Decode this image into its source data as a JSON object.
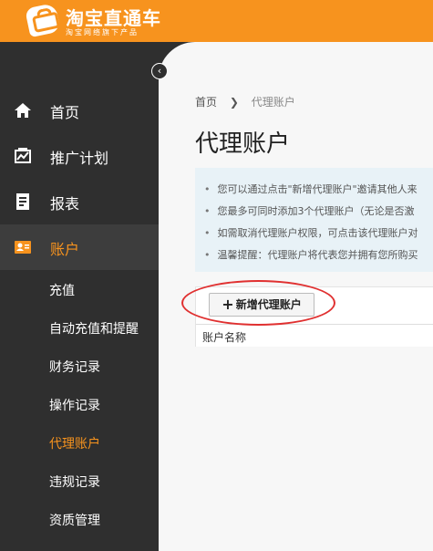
{
  "header": {
    "logo_title": "淘宝直通车",
    "logo_subtitle": "淘宝网络旗下产品",
    "brand_color": "#f7931e"
  },
  "sidebar": {
    "bg_color": "#2f2f2f",
    "collapse_icon": "chevron-left-icon",
    "items": [
      {
        "label": "首页",
        "icon": "home-icon"
      },
      {
        "label": "推广计划",
        "icon": "campaign-icon"
      },
      {
        "label": "报表",
        "icon": "report-icon"
      },
      {
        "label": "账户",
        "icon": "account-icon",
        "active": true
      }
    ],
    "sub_items": [
      {
        "label": "充值"
      },
      {
        "label": "自动充值和提醒"
      },
      {
        "label": "财务记录"
      },
      {
        "label": "操作记录"
      },
      {
        "label": "代理账户",
        "active": true
      },
      {
        "label": "违规记录"
      },
      {
        "label": "资质管理"
      }
    ]
  },
  "breadcrumb": {
    "home": "首页",
    "separator": "❯",
    "current": "代理账户"
  },
  "page_title": "代理账户",
  "notice": {
    "lines": [
      "您可以通过点击\"新增代理账户\"邀请其他人来",
      "您最多可同时添加3个代理账户（无论是否激",
      "如需取消代理账户权限，可点击该代理账户对",
      "温馨提醒：代理账户将代表您并拥有您所购买"
    ]
  },
  "panel": {
    "add_button_label": "新增代理账户",
    "add_button_icon": "plus-icon",
    "column_header": "账户名称"
  },
  "annotation_color": "#e03030"
}
